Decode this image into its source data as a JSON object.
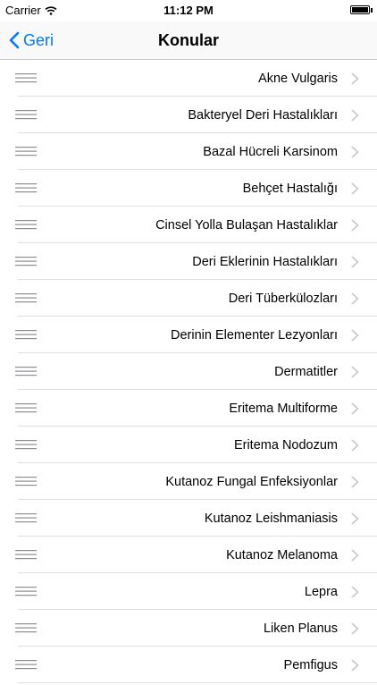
{
  "status": {
    "carrier": "Carrier",
    "time": "11:12 PM"
  },
  "nav": {
    "back_label": "Geri",
    "title": "Konular"
  },
  "topics": [
    "Akne Vulgaris",
    "Bakteryel Deri Hastalıkları",
    "Bazal Hücreli Karsinom",
    "Behçet Hastalığı",
    "Cinsel Yolla Bulaşan Hastalıklar",
    "Deri Eklerinin Hastalıkları",
    "Deri Tüberkülozları",
    "Derinin Elementer Lezyonları",
    "Dermatitler",
    "Eritema Multiforme",
    "Eritema Nodozum",
    "Kutanoz Fungal Enfeksiyonlar",
    "Kutanoz Leishmaniasis",
    "Kutanoz Melanoma",
    "Lepra",
    "Liken Planus",
    "Pemfigus"
  ],
  "colors": {
    "accent": "#007aff",
    "separator": "#e0e0e0",
    "chevron": "#c7c7cc",
    "reorder": "#8e8e93"
  }
}
